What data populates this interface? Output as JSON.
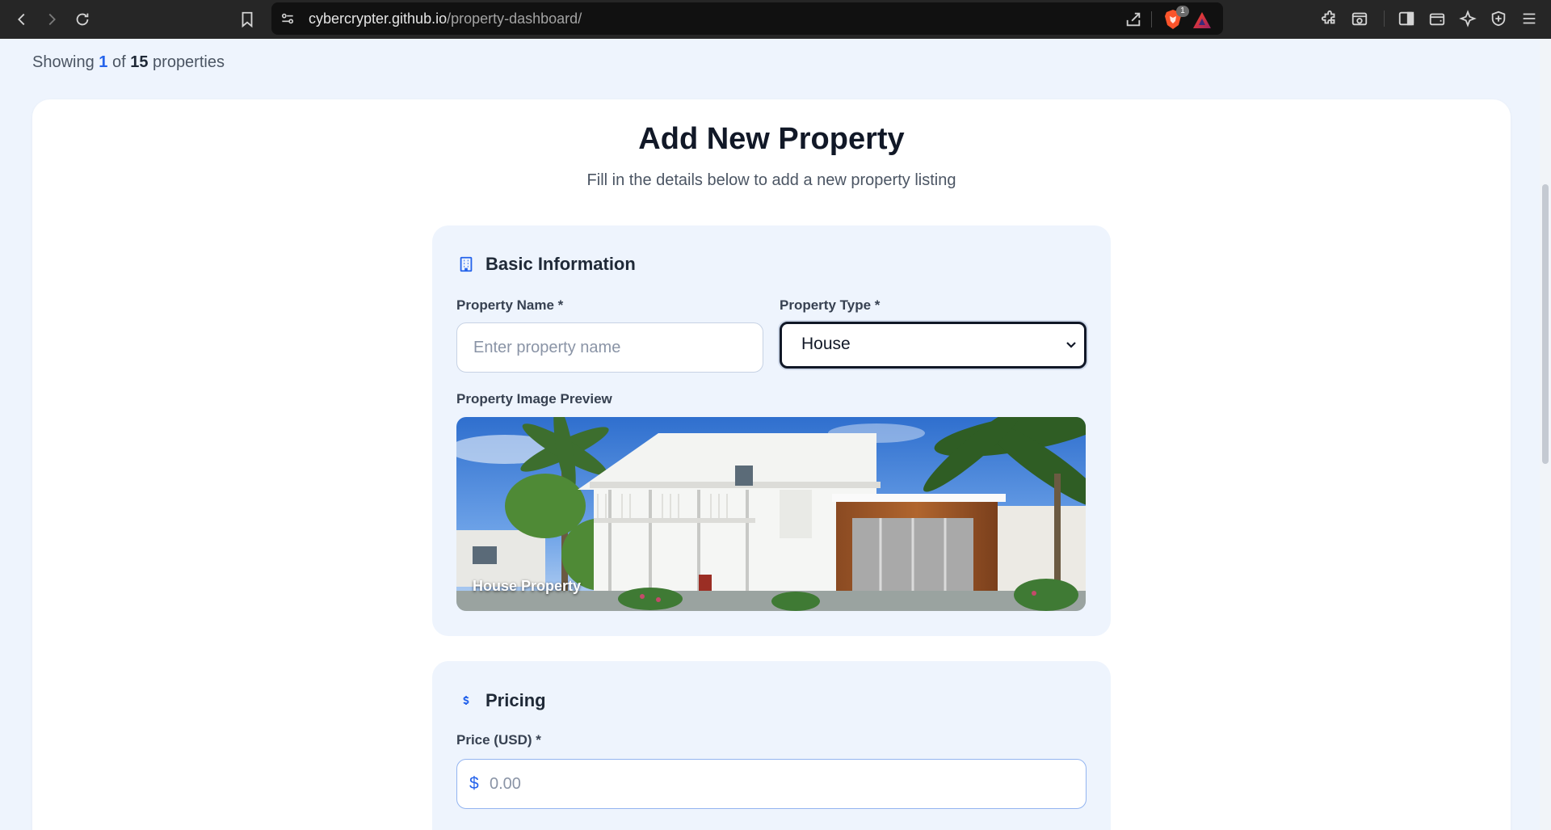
{
  "browser": {
    "url_host": "cybercrypter.github.io",
    "url_path": "/property-dashboard/",
    "shields_badge": "1",
    "icons": [
      "back-icon",
      "forward-icon",
      "reload-icon",
      "bookmark-icon",
      "site-info-icon",
      "share-icon",
      "brave-shields-icon",
      "brave-rewards-icon",
      "extensions-icon",
      "screenshot-icon",
      "sidebar-icon",
      "wallet-icon",
      "leo-ai-icon",
      "vpn-icon",
      "menu-icon"
    ]
  },
  "listing": {
    "prefix": "Showing",
    "current": "1",
    "of": "of",
    "total": "15",
    "suffix": "properties"
  },
  "form": {
    "title": "Add New Property",
    "subtitle": "Fill in the details below to add a new property listing",
    "basic": {
      "heading": "Basic Information",
      "icon": "building-icon",
      "name_label": "Property Name *",
      "name_placeholder": "Enter property name",
      "name_value": "",
      "type_label": "Property Type *",
      "type_value": "House",
      "preview_label": "Property Image Preview",
      "preview_caption": "House Property"
    },
    "pricing": {
      "heading": "Pricing",
      "icon": "dollar-icon",
      "price_label": "Price (USD) *",
      "currency_symbol": "$",
      "price_placeholder": "0.00",
      "price_value": ""
    }
  },
  "colors": {
    "accent": "#2563eb",
    "page_bg": "#eef4fd",
    "card_bg": "#ffffff",
    "chrome_bg": "#262626"
  }
}
